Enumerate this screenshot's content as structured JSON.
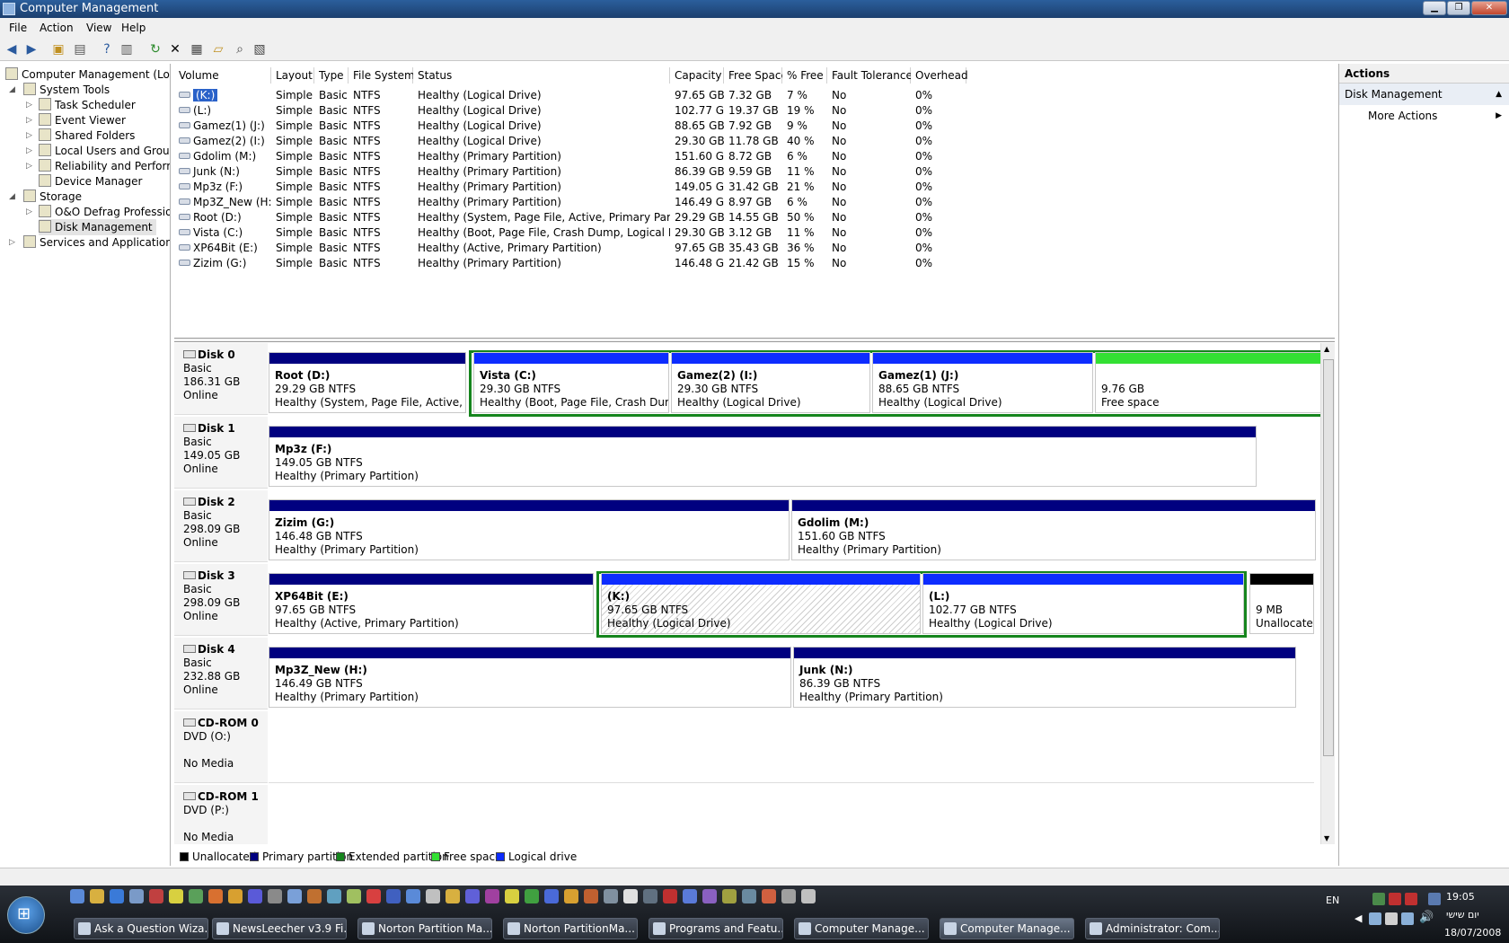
{
  "window": {
    "title": "Computer Management"
  },
  "menu": [
    "File",
    "Action",
    "View",
    "Help"
  ],
  "tree": {
    "root": "Computer Management (Local",
    "system_tools": "System Tools",
    "task_scheduler": "Task Scheduler",
    "event_viewer": "Event Viewer",
    "shared_folders": "Shared Folders",
    "local_users": "Local Users and Groups",
    "reliability": "Reliability and Performa",
    "device_manager": "Device Manager",
    "storage": "Storage",
    "defrag": "O&O Defrag Profession",
    "disk_management": "Disk Management",
    "services": "Services and Applications"
  },
  "volume_columns": [
    "Volume",
    "Layout",
    "Type",
    "File System",
    "Status",
    "Capacity",
    "Free Space",
    "% Free",
    "Fault Tolerance",
    "Overhead"
  ],
  "volumes": [
    {
      "volume": "(K:)",
      "layout": "Simple",
      "type": "Basic",
      "fs": "NTFS",
      "status": "Healthy (Logical Drive)",
      "capacity": "97.65 GB",
      "free": "7.32 GB",
      "pct": "7 %",
      "fault": "No",
      "overhead": "0%"
    },
    {
      "volume": "(L:)",
      "layout": "Simple",
      "type": "Basic",
      "fs": "NTFS",
      "status": "Healthy (Logical Drive)",
      "capacity": "102.77 GB",
      "free": "19.37 GB",
      "pct": "19 %",
      "fault": "No",
      "overhead": "0%"
    },
    {
      "volume": "Gamez(1) (J:)",
      "layout": "Simple",
      "type": "Basic",
      "fs": "NTFS",
      "status": "Healthy (Logical Drive)",
      "capacity": "88.65 GB",
      "free": "7.92 GB",
      "pct": "9 %",
      "fault": "No",
      "overhead": "0%"
    },
    {
      "volume": "Gamez(2) (I:)",
      "layout": "Simple",
      "type": "Basic",
      "fs": "NTFS",
      "status": "Healthy (Logical Drive)",
      "capacity": "29.30 GB",
      "free": "11.78 GB",
      "pct": "40 %",
      "fault": "No",
      "overhead": "0%"
    },
    {
      "volume": "Gdolim (M:)",
      "layout": "Simple",
      "type": "Basic",
      "fs": "NTFS",
      "status": "Healthy (Primary Partition)",
      "capacity": "151.60 GB",
      "free": "8.72 GB",
      "pct": "6 %",
      "fault": "No",
      "overhead": "0%"
    },
    {
      "volume": "Junk (N:)",
      "layout": "Simple",
      "type": "Basic",
      "fs": "NTFS",
      "status": "Healthy (Primary Partition)",
      "capacity": "86.39 GB",
      "free": "9.59 GB",
      "pct": "11 %",
      "fault": "No",
      "overhead": "0%"
    },
    {
      "volume": "Mp3z (F:)",
      "layout": "Simple",
      "type": "Basic",
      "fs": "NTFS",
      "status": "Healthy (Primary Partition)",
      "capacity": "149.05 GB",
      "free": "31.42 GB",
      "pct": "21 %",
      "fault": "No",
      "overhead": "0%"
    },
    {
      "volume": "Mp3Z_New (H:)",
      "layout": "Simple",
      "type": "Basic",
      "fs": "NTFS",
      "status": "Healthy (Primary Partition)",
      "capacity": "146.49 GB",
      "free": "8.97 GB",
      "pct": "6 %",
      "fault": "No",
      "overhead": "0%"
    },
    {
      "volume": "Root (D:)",
      "layout": "Simple",
      "type": "Basic",
      "fs": "NTFS",
      "status": "Healthy (System, Page File, Active, Primary Partition)",
      "capacity": "29.29 GB",
      "free": "14.55 GB",
      "pct": "50 %",
      "fault": "No",
      "overhead": "0%"
    },
    {
      "volume": "Vista (C:)",
      "layout": "Simple",
      "type": "Basic",
      "fs": "NTFS",
      "status": "Healthy (Boot, Page File, Crash Dump, Logical Drive)",
      "capacity": "29.30 GB",
      "free": "3.12 GB",
      "pct": "11 %",
      "fault": "No",
      "overhead": "0%"
    },
    {
      "volume": "XP64Bit (E:)",
      "layout": "Simple",
      "type": "Basic",
      "fs": "NTFS",
      "status": "Healthy (Active, Primary Partition)",
      "capacity": "97.65 GB",
      "free": "35.43 GB",
      "pct": "36 %",
      "fault": "No",
      "overhead": "0%"
    },
    {
      "volume": "Zizim (G:)",
      "layout": "Simple",
      "type": "Basic",
      "fs": "NTFS",
      "status": "Healthy (Primary Partition)",
      "capacity": "146.48 GB",
      "free": "21.42 GB",
      "pct": "15 %",
      "fault": "No",
      "overhead": "0%"
    }
  ],
  "disks": [
    {
      "name": "Disk 0",
      "type": "Basic",
      "size": "186.31 GB",
      "state": "Online"
    },
    {
      "name": "Disk 1",
      "type": "Basic",
      "size": "149.05 GB",
      "state": "Online"
    },
    {
      "name": "Disk 2",
      "type": "Basic",
      "size": "298.09 GB",
      "state": "Online"
    },
    {
      "name": "Disk 3",
      "type": "Basic",
      "size": "298.09 GB",
      "state": "Online"
    },
    {
      "name": "Disk 4",
      "type": "Basic",
      "size": "232.88 GB",
      "state": "Online"
    },
    {
      "name": "CD-ROM 0",
      "type": "DVD (O:)",
      "size": "",
      "state": "No Media"
    },
    {
      "name": "CD-ROM 1",
      "type": "DVD (P:)",
      "size": "",
      "state": "No Media"
    }
  ],
  "partitions": {
    "d0_root": {
      "name": "Root  (D:)",
      "size": "29.29 GB NTFS",
      "status": "Healthy (System, Page File, Active, Prim"
    },
    "d0_vista": {
      "name": "Vista  (C:)",
      "size": "29.30 GB NTFS",
      "status": "Healthy (Boot, Page File, Crash Dump,"
    },
    "d0_gamez2": {
      "name": "Gamez(2)  (I:)",
      "size": "29.30 GB NTFS",
      "status": "Healthy (Logical Drive)"
    },
    "d0_gamez1": {
      "name": "Gamez(1)  (J:)",
      "size": "88.65 GB NTFS",
      "status": "Healthy (Logical Drive)"
    },
    "d0_free": {
      "name": "",
      "size": "9.76 GB",
      "status": "Free space"
    },
    "d1_mp3z": {
      "name": "Mp3z  (F:)",
      "size": "149.05 GB NTFS",
      "status": "Healthy (Primary Partition)"
    },
    "d2_zizim": {
      "name": "Zizim  (G:)",
      "size": "146.48 GB NTFS",
      "status": "Healthy (Primary Partition)"
    },
    "d2_gdolim": {
      "name": "Gdolim  (M:)",
      "size": "151.60 GB NTFS",
      "status": "Healthy (Primary Partition)"
    },
    "d3_xp64": {
      "name": "XP64Bit  (E:)",
      "size": "97.65 GB NTFS",
      "status": "Healthy (Active, Primary Partition)"
    },
    "d3_k": {
      "name": "(K:)",
      "size": "97.65 GB NTFS",
      "status": "Healthy (Logical Drive)"
    },
    "d3_l": {
      "name": "(L:)",
      "size": "102.77 GB NTFS",
      "status": "Healthy (Logical Drive)"
    },
    "d3_unalloc": {
      "name": "",
      "size": "9 MB",
      "status": "Unallocated"
    },
    "d4_mp3znew": {
      "name": "Mp3Z_New  (H:)",
      "size": "146.49 GB NTFS",
      "status": "Healthy (Primary Partition)"
    },
    "d4_junk": {
      "name": "Junk  (N:)",
      "size": "86.39 GB NTFS",
      "status": "Healthy (Primary Partition)"
    }
  },
  "legend": [
    "Unallocated",
    "Primary partition",
    "Extended partition",
    "Free space",
    "Logical drive"
  ],
  "colors": {
    "unallocated": "#000000",
    "primary": "#000080",
    "extended": "#15851d",
    "free": "#33e033",
    "logical": "#0d2cff"
  },
  "actions": {
    "header": "Actions",
    "section": "Disk Management",
    "more": "More Actions"
  },
  "taskbar": {
    "buttons": [
      "Ask a Question Wiza...",
      "NewsLeecher v3.9 Fi...",
      "Norton Partition Ma...",
      "Norton PartitionMa...",
      "Programs and Featu...",
      "Computer Manage...",
      "Computer Manage...",
      "Administrator: Com..."
    ],
    "lang": "EN",
    "time": "19:05",
    "day": "יום שישי",
    "date": "18/07/2008"
  }
}
